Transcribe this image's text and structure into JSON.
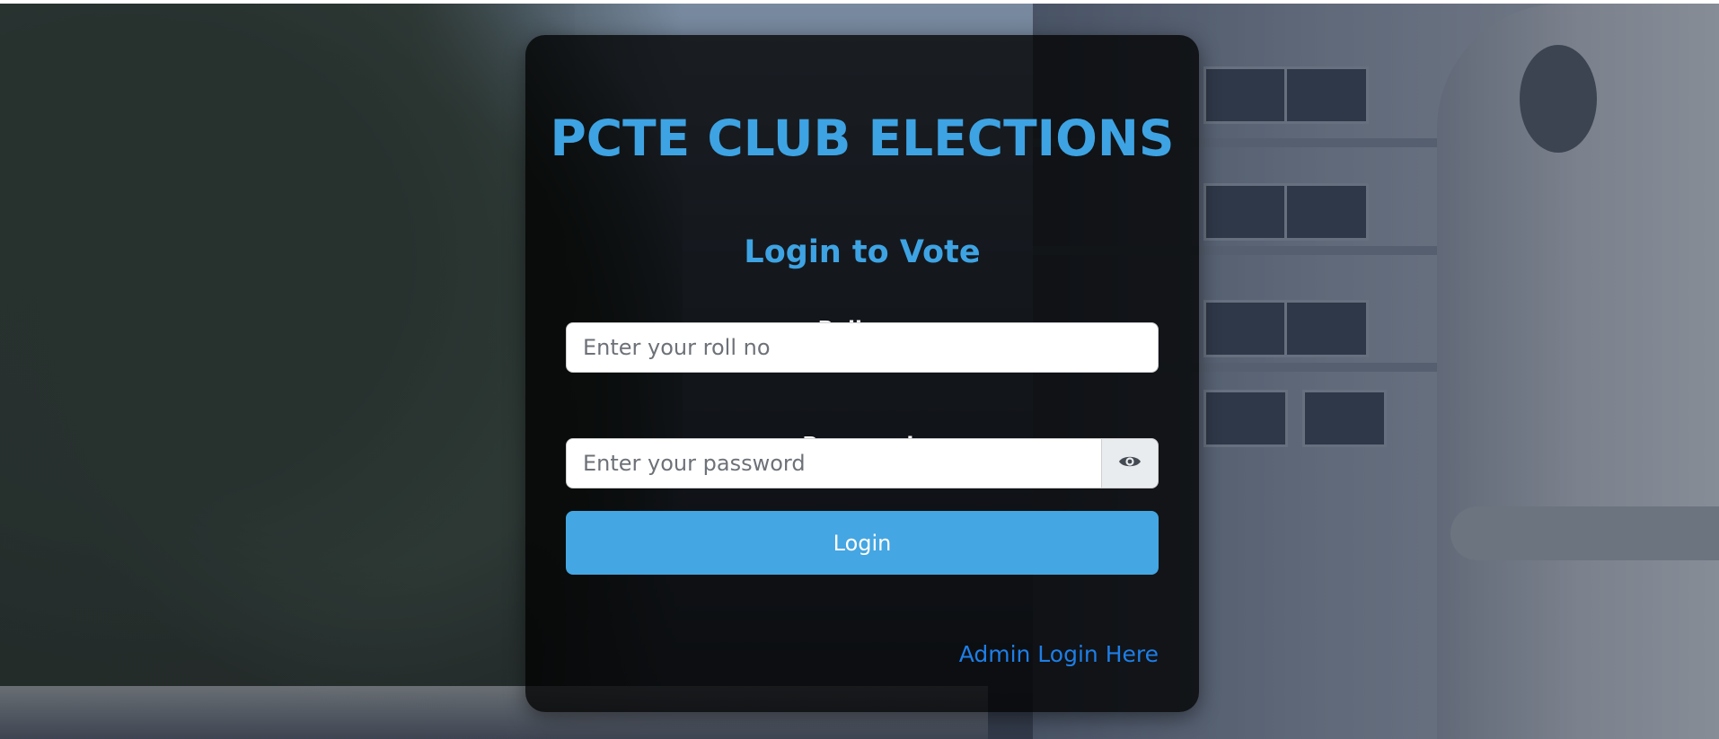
{
  "header": {
    "title": "PCTE CLUB ELECTIONS",
    "subtitle": "Login to Vote"
  },
  "form": {
    "roll_label": "Roll no:",
    "roll_placeholder": "Enter your roll no",
    "roll_value": "",
    "password_label": "Password:",
    "password_placeholder": "Enter your password",
    "password_value": "",
    "toggle_icon": "eye-icon",
    "login_label": "Login"
  },
  "footer": {
    "admin_link": "Admin Login Here"
  },
  "colors": {
    "accent": "#3ea3e3",
    "button": "#44a6e2",
    "link": "#1e7ee6",
    "card_background": "rgba(0,0,0,0.78)"
  }
}
